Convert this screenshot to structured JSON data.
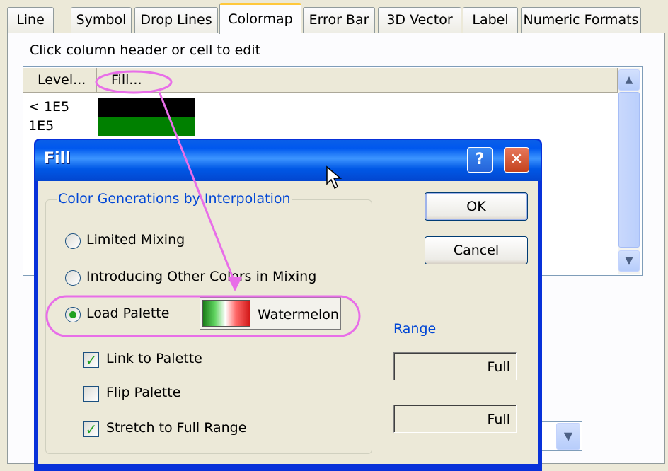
{
  "tabs": [
    {
      "label": "Line"
    },
    {
      "label": "Symbol"
    },
    {
      "label": "Drop Lines"
    },
    {
      "label": "Colormap"
    },
    {
      "label": "Error Bar"
    },
    {
      "label": "3D Vector"
    },
    {
      "label": "Label"
    },
    {
      "label": "Numeric Formats"
    }
  ],
  "hint": "Click column header or cell to edit",
  "grid": {
    "headers": [
      "Level...",
      "Fill..."
    ],
    "rows": [
      {
        "level": "< 1E5",
        "fill_color": "#000000"
      },
      {
        "level": "1E5",
        "fill_color": "#008000"
      }
    ]
  },
  "dialog": {
    "title": "Fill",
    "help_label": "?",
    "close_label": "✕",
    "group_title": "Color Generations by Interpolation",
    "radio_limited": "Limited Mixing",
    "radio_other": "Introducing Other Colors in Mixing",
    "radio_load": "Load Palette",
    "palette_name": "Watermelon",
    "chk_link": "Link to Palette",
    "chk_flip": "Flip Palette",
    "chk_stretch": "Stretch to Full Range",
    "ok_label": "OK",
    "cancel_label": "Cancel",
    "range_title": "Range",
    "range_min": "Full",
    "range_max": "Full",
    "state": {
      "selected_radio": "load",
      "link_to_palette": true,
      "flip_palette": false,
      "stretch_to_full_range": true
    }
  },
  "colors": {
    "annotation": "#e86ee8",
    "accent_title": "#0058e6",
    "link_text": "#0046d5"
  }
}
